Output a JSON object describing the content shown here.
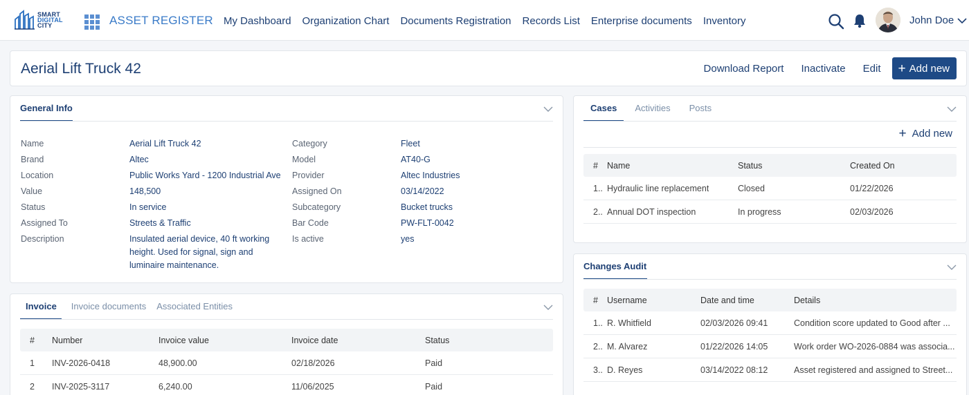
{
  "brand": {
    "logo_lines": [
      "SMART",
      "DIGITAL",
      "CITY"
    ],
    "app_title": "ASSET REGISTER"
  },
  "nav": [
    "My Dashboard",
    "Organization Chart",
    "Documents Registration",
    "Records List",
    "Enterprise documents",
    "Inventory"
  ],
  "user": {
    "name": "John Doe"
  },
  "page": {
    "title": "Aerial Lift Truck 42",
    "actions": {
      "download": "Download Report",
      "inactivate": "Inactivate",
      "edit": "Edit",
      "add_new": "Add new"
    }
  },
  "general_info": {
    "tab": "General Info",
    "left": [
      {
        "label": "Name",
        "value": "Aerial Lift Truck 42"
      },
      {
        "label": "Brand",
        "value": "Altec"
      },
      {
        "label": "Location",
        "value": "Public Works Yard - 1200 Industrial Ave"
      },
      {
        "label": "Value",
        "value": "148,500"
      },
      {
        "label": "Status",
        "value": "In service"
      },
      {
        "label": "Assigned To",
        "value": "Streets & Traffic"
      },
      {
        "label": "Description",
        "value_lines": [
          "Insulated aerial device, 40 ft working",
          "height. Used for signal, sign and",
          "luminaire maintenance."
        ]
      }
    ],
    "right": [
      {
        "label": "Category",
        "value": "Fleet"
      },
      {
        "label": "Model",
        "value": "AT40-G"
      },
      {
        "label": "Provider",
        "value": "Altec Industries"
      },
      {
        "label": "Assigned On",
        "value": "03/14/2022"
      },
      {
        "label": "Subcategory",
        "value": "Bucket trucks"
      },
      {
        "label": "Bar Code",
        "value": "PW-FLT-0042"
      },
      {
        "label": "Is active",
        "value": "yes"
      }
    ]
  },
  "invoice": {
    "tabs": [
      "Invoice",
      "Invoice documents",
      "Associated Entities"
    ],
    "headers": [
      "#",
      "Number",
      "Invoice value",
      "Invoice date",
      "Status"
    ],
    "rows": [
      [
        "1",
        "INV-2026-0418",
        "48,900.00",
        "02/18/2026",
        "Paid"
      ],
      [
        "2",
        "INV-2025-3117",
        "6,240.00",
        "11/06/2025",
        "Paid"
      ]
    ]
  },
  "cases": {
    "tabs": [
      "Cases",
      "Activities",
      "Posts"
    ],
    "add_new": "Add new",
    "headers": [
      "#",
      "Name",
      "Status",
      "Created On"
    ],
    "rows": [
      [
        "1..",
        "Hydraulic line replacement",
        "Closed",
        "01/22/2026"
      ],
      [
        "2..",
        "Annual DOT inspection",
        "In progress",
        "02/03/2026"
      ]
    ]
  },
  "audit": {
    "tab": "Changes Audit",
    "headers": [
      "#",
      "Username",
      "Date and time",
      "Details"
    ],
    "rows": [
      [
        "1..",
        "R. Whitfield",
        "02/03/2026 09:41",
        "Condition score updated to Good after ..."
      ],
      [
        "2..",
        "M. Alvarez",
        "01/22/2026 14:05",
        "Work order WO-2026-0884 was associa..."
      ],
      [
        "3..",
        "D. Reyes",
        "03/14/2022 08:12",
        "Asset registered and assigned to Street..."
      ]
    ]
  }
}
